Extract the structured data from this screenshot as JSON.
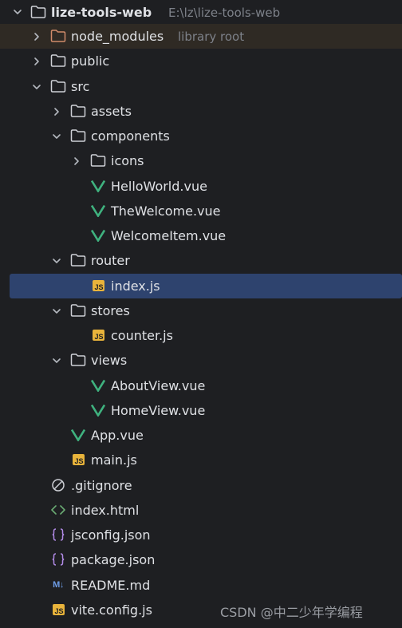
{
  "project": {
    "name": "lize-tools-web",
    "path": "E:\\lz\\lize-tools-web"
  },
  "tree": [
    {
      "label": "node_modules",
      "hint": "library root",
      "type": "folder-excluded",
      "chevron": "right",
      "icon": "folder-icon"
    },
    {
      "label": "public",
      "type": "folder",
      "chevron": "right",
      "icon": "folder-icon"
    },
    {
      "label": "src",
      "type": "folder",
      "chevron": "down",
      "icon": "folder-icon"
    },
    {
      "label": "assets",
      "type": "folder",
      "chevron": "right",
      "icon": "folder-icon"
    },
    {
      "label": "components",
      "type": "folder",
      "chevron": "down",
      "icon": "folder-icon"
    },
    {
      "label": "icons",
      "type": "folder",
      "chevron": "right",
      "icon": "folder-icon"
    },
    {
      "label": "HelloWorld.vue",
      "type": "vue",
      "icon": "vue-icon"
    },
    {
      "label": "TheWelcome.vue",
      "type": "vue",
      "icon": "vue-icon"
    },
    {
      "label": "WelcomeItem.vue",
      "type": "vue",
      "icon": "vue-icon"
    },
    {
      "label": "router",
      "type": "folder",
      "chevron": "down",
      "icon": "folder-icon"
    },
    {
      "label": "index.js",
      "type": "js",
      "icon": "js-icon",
      "selected": true
    },
    {
      "label": "stores",
      "type": "folder",
      "chevron": "down",
      "icon": "folder-icon"
    },
    {
      "label": "counter.js",
      "type": "js",
      "icon": "js-icon"
    },
    {
      "label": "views",
      "type": "folder",
      "chevron": "down",
      "icon": "folder-icon"
    },
    {
      "label": "AboutView.vue",
      "type": "vue",
      "icon": "vue-icon"
    },
    {
      "label": "HomeView.vue",
      "type": "vue",
      "icon": "vue-icon"
    },
    {
      "label": "App.vue",
      "type": "vue",
      "icon": "vue-icon"
    },
    {
      "label": "main.js",
      "type": "js",
      "icon": "js-icon"
    },
    {
      "label": ".gitignore",
      "type": "ignore",
      "icon": "gitignore-icon"
    },
    {
      "label": "index.html",
      "type": "html",
      "icon": "html-icon"
    },
    {
      "label": "jsconfig.json",
      "type": "json",
      "icon": "json-icon"
    },
    {
      "label": "package.json",
      "type": "json",
      "icon": "json-icon"
    },
    {
      "label": "README.md",
      "type": "md",
      "icon": "markdown-icon"
    },
    {
      "label": "vite.config.js",
      "type": "js",
      "icon": "js-icon"
    }
  ],
  "icon_text": {
    "js": "JS",
    "md": "M↓"
  },
  "colors": {
    "background": "#1e1f22",
    "selection": "#2e436e",
    "excluded_row": "#2f2a24",
    "folder": "#ced0d6",
    "excluded_folder": "#d08b6a",
    "vue": "#3fb27f",
    "js": "#e8b33b",
    "html": "#6aab73",
    "json": "#b18ae6",
    "markdown": "#6e9ce6"
  },
  "watermark": "CSDN @中二少年学编程"
}
